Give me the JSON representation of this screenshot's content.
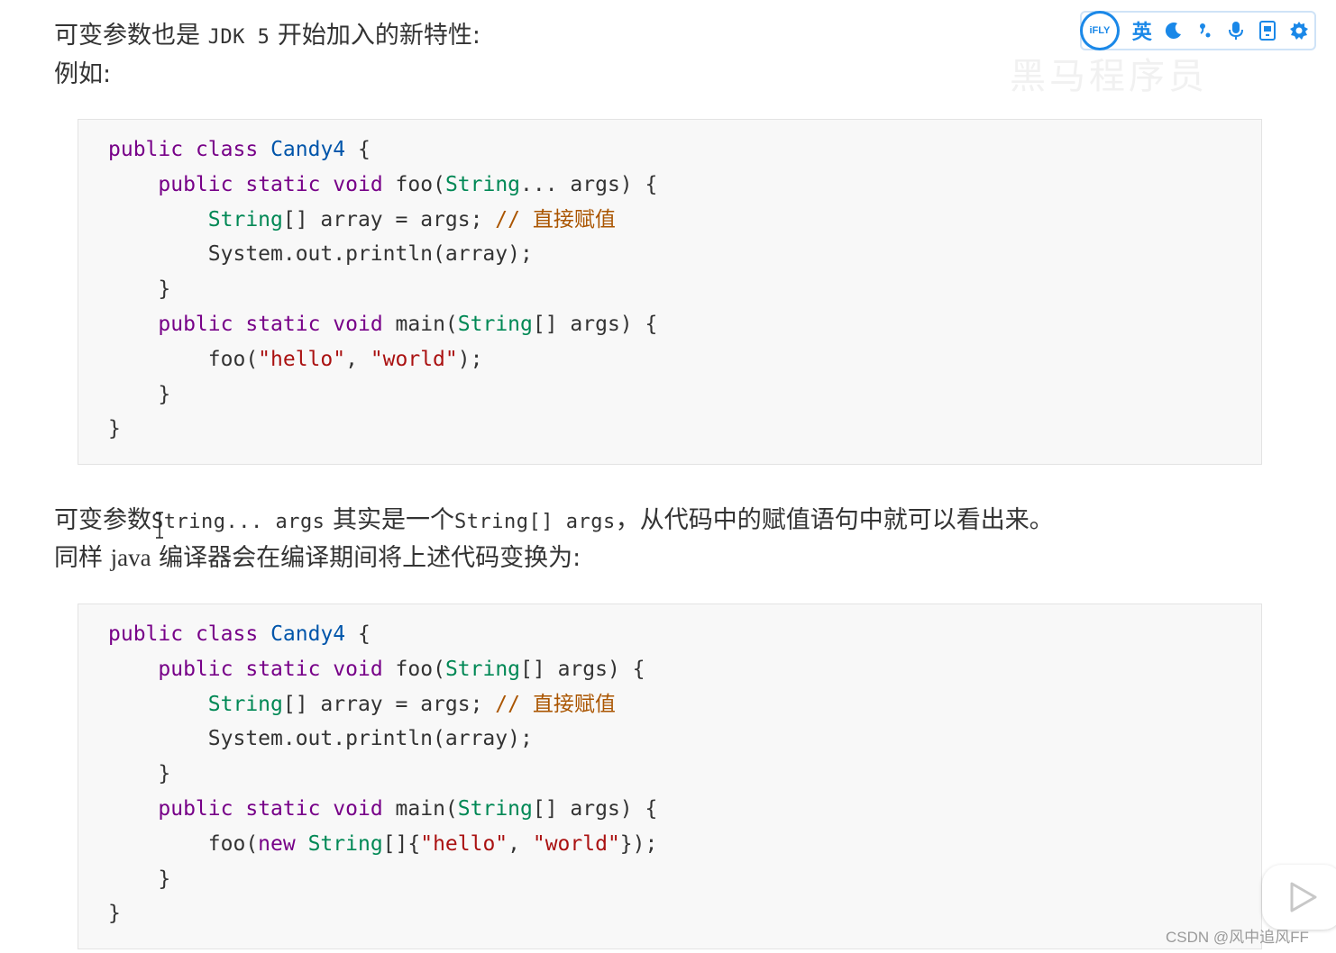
{
  "intro": {
    "line1_prefix": "可变参数也是",
    "line1_code": "JDK 5",
    "line1_suffix": "开始加入的新特性:",
    "line2": "例如:"
  },
  "code_block_1": {
    "lines": [
      [
        {
          "t": "public",
          "c": "kw"
        },
        {
          "t": " "
        },
        {
          "t": "class",
          "c": "kw"
        },
        {
          "t": " "
        },
        {
          "t": "Candy4",
          "c": "cls"
        },
        {
          "t": " {"
        }
      ],
      [
        {
          "t": "    "
        },
        {
          "t": "public",
          "c": "kw"
        },
        {
          "t": " "
        },
        {
          "t": "static",
          "c": "kw"
        },
        {
          "t": " "
        },
        {
          "t": "void",
          "c": "kw"
        },
        {
          "t": " foo("
        },
        {
          "t": "String",
          "c": "typ"
        },
        {
          "t": "... args) {"
        }
      ],
      [
        {
          "t": "        "
        },
        {
          "t": "String",
          "c": "typ"
        },
        {
          "t": "[] array = args; "
        },
        {
          "t": "// ",
          "c": "cmt"
        },
        {
          "t": "直接赋值",
          "c": "cmt zh"
        }
      ],
      [
        {
          "t": "        System.out.println(array);"
        }
      ],
      [
        {
          "t": "    }"
        }
      ],
      [
        {
          "t": "    "
        },
        {
          "t": "public",
          "c": "kw"
        },
        {
          "t": " "
        },
        {
          "t": "static",
          "c": "kw"
        },
        {
          "t": " "
        },
        {
          "t": "void",
          "c": "kw"
        },
        {
          "t": " main("
        },
        {
          "t": "String",
          "c": "typ"
        },
        {
          "t": "[] args) {"
        }
      ],
      [
        {
          "t": "        foo("
        },
        {
          "t": "\"hello\"",
          "c": "str"
        },
        {
          "t": ", "
        },
        {
          "t": "\"world\"",
          "c": "str"
        },
        {
          "t": ");"
        }
      ],
      [
        {
          "t": "    }"
        }
      ],
      [
        {
          "t": "}"
        }
      ]
    ]
  },
  "explanation": {
    "line1_part1": "可变参数",
    "line1_code1": "String... args",
    "line1_part2": "其实是一个",
    "line1_code2": "String[] args",
    "line1_part3": "，从代码中的赋值语句中就可以看出来。",
    "line2_part1": "同样",
    "line2_java": "java",
    "line2_part2": "编译器会在编译期间将上述代码变换为:"
  },
  "code_block_2": {
    "lines": [
      [
        {
          "t": "public",
          "c": "kw"
        },
        {
          "t": " "
        },
        {
          "t": "class",
          "c": "kw"
        },
        {
          "t": " "
        },
        {
          "t": "Candy4",
          "c": "cls"
        },
        {
          "t": " {"
        }
      ],
      [
        {
          "t": "    "
        },
        {
          "t": "public",
          "c": "kw"
        },
        {
          "t": " "
        },
        {
          "t": "static",
          "c": "kw"
        },
        {
          "t": " "
        },
        {
          "t": "void",
          "c": "kw"
        },
        {
          "t": " foo("
        },
        {
          "t": "String",
          "c": "typ"
        },
        {
          "t": "[] args) {"
        }
      ],
      [
        {
          "t": "        "
        },
        {
          "t": "String",
          "c": "typ"
        },
        {
          "t": "[] array = args; "
        },
        {
          "t": "// ",
          "c": "cmt"
        },
        {
          "t": "直接赋值",
          "c": "cmt zh"
        }
      ],
      [
        {
          "t": "        System.out.println(array);"
        }
      ],
      [
        {
          "t": "    }"
        }
      ],
      [
        {
          "t": "    "
        },
        {
          "t": "public",
          "c": "kw"
        },
        {
          "t": " "
        },
        {
          "t": "static",
          "c": "kw"
        },
        {
          "t": " "
        },
        {
          "t": "void",
          "c": "kw"
        },
        {
          "t": " main("
        },
        {
          "t": "String",
          "c": "typ"
        },
        {
          "t": "[] args) {"
        }
      ],
      [
        {
          "t": "        foo("
        },
        {
          "t": "new",
          "c": "kw"
        },
        {
          "t": " "
        },
        {
          "t": "String",
          "c": "typ"
        },
        {
          "t": "[]{"
        },
        {
          "t": "\"hello\"",
          "c": "str"
        },
        {
          "t": ", "
        },
        {
          "t": "\"world\"",
          "c": "str"
        },
        {
          "t": "});"
        }
      ],
      [
        {
          "t": "    }"
        }
      ],
      [
        {
          "t": "}"
        }
      ]
    ]
  },
  "ifly_toolbar": {
    "logo_text": "iFLY",
    "language_label": "英",
    "icons": [
      "moon-icon",
      "punctuation-icon",
      "microphone-icon",
      "keyboard-icon",
      "settings-icon"
    ],
    "accent_color": "#1a88e8"
  },
  "watermark": {
    "faint_text": "黑马程序员"
  },
  "video_overlay": {
    "icon": "play-icon"
  },
  "footer": {
    "credit": "CSDN @风中追风FF"
  },
  "syntax_colors": {
    "keyword": "#770088",
    "class_name": "#0055aa",
    "type": "#008855",
    "string": "#aa1111",
    "comment": "#aa5500"
  }
}
